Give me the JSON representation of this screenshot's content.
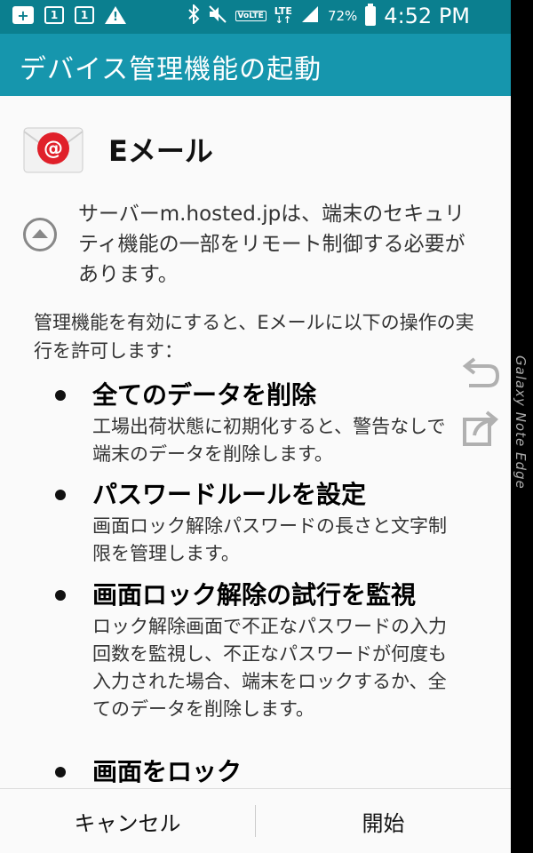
{
  "status_bar": {
    "sim1": "1",
    "sim2": "1",
    "volte": "VoLTE",
    "lte": "LTE",
    "battery": "72%",
    "time": "4:52 PM"
  },
  "title_bar": {
    "title": "デバイス管理機能の起動"
  },
  "app": {
    "name": "Eメール",
    "icon": "email-at-icon"
  },
  "server_message": "サーバーm.hosted.jpは、端末のセキュリティ機能の一部をリモート制御する必要があります。",
  "intro": "管理機能を有効にすると、Eメールに以下の操作の実行を許可します：",
  "permissions": [
    {
      "title": "全てのデータを削除",
      "desc": "工場出荷状態に初期化すると、警告なしで端末のデータを削除します。"
    },
    {
      "title": "パスワードルールを設定",
      "desc": "画面ロック解除パスワードの長さと文字制限を管理します。"
    },
    {
      "title": "画面ロック解除の試行を監視",
      "desc": "ロック解除画面で不正なパスワードの入力回数を監視し、不正なパスワードが何度も入力された場合、端末をロックするか、全てのデータを削除します。"
    },
    {
      "title": "画面をロック",
      "desc": ""
    }
  ],
  "buttons": {
    "cancel": "キャンセル",
    "start": "開始"
  },
  "edge": {
    "label": "Galaxy Note Edge"
  },
  "colors": {
    "status_bar": "#0b7f8f",
    "title_bar": "#1696ad",
    "email_red": "#e0202a"
  }
}
